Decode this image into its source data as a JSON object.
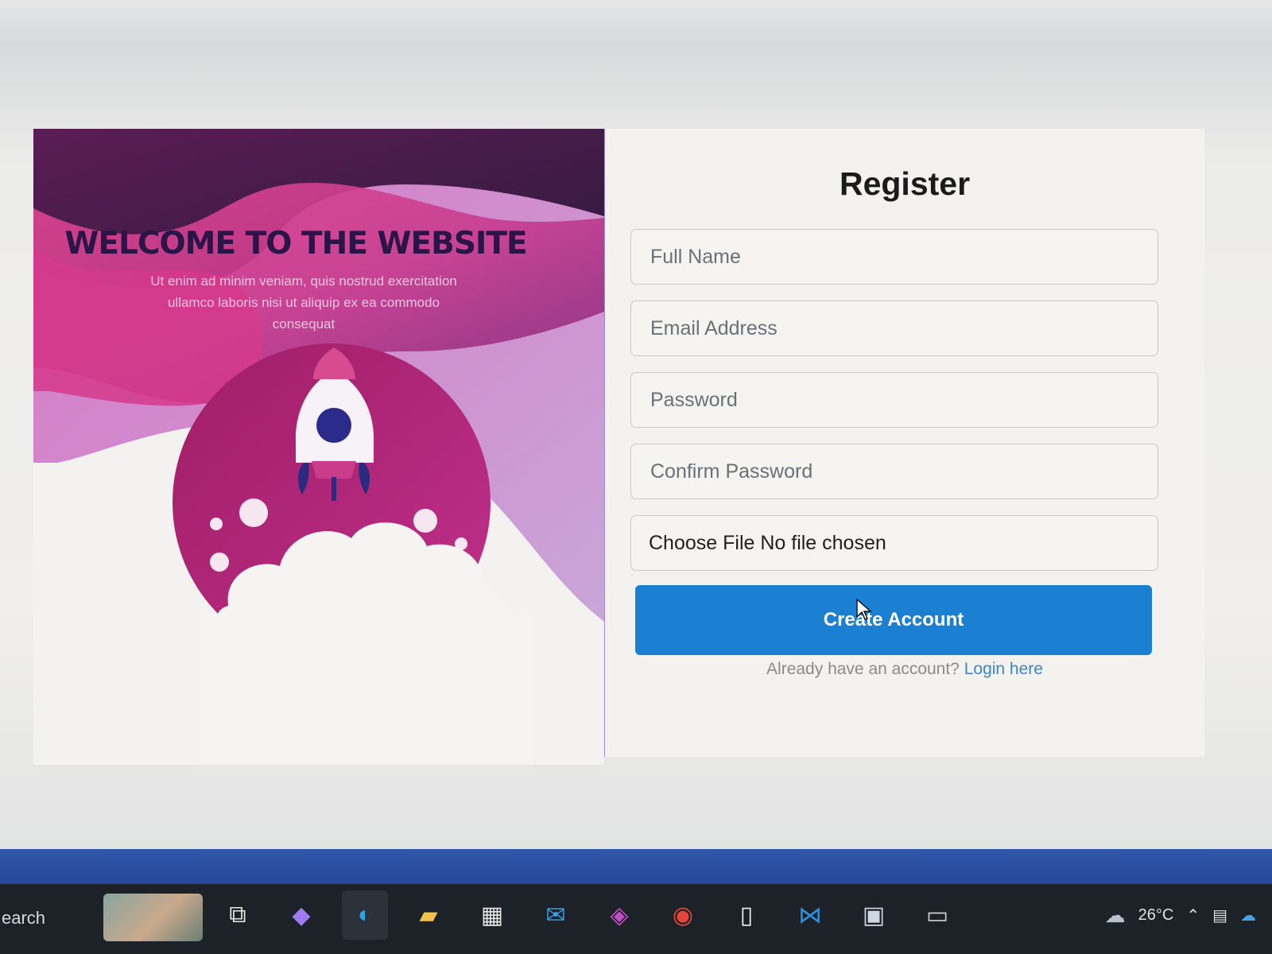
{
  "hero": {
    "title": "WELCOME TO THE WEBSITE",
    "subtitle": "Ut enim ad minim veniam, quis nostrud exercitation ullamco laboris nisi ut aliquip ex ea commodo consequat"
  },
  "form": {
    "title": "Register",
    "full_name_placeholder": "Full Name",
    "email_placeholder": "Email Address",
    "password_placeholder": "Password",
    "confirm_password_placeholder": "Confirm Password",
    "file_label": "Choose File No file chosen",
    "submit_label": "Create Account",
    "login_prompt": "Already have an account?",
    "login_link": "Login here"
  },
  "taskbar": {
    "search_label": "earch",
    "weather": "26°C",
    "icons": [
      "task-view-icon",
      "copilot-icon",
      "edge-icon",
      "file-explorer-icon",
      "store-icon",
      "mail-icon",
      "m365-icon",
      "chrome-icon",
      "notepad-icon",
      "vscode-icon",
      "remote-desktop-icon",
      "terminal-icon"
    ]
  },
  "colors": {
    "accent": "#1b7fd2",
    "hero_dark": "#3f1a45",
    "hero_pink": "#d0449a",
    "title_dark": "#2a1448"
  }
}
